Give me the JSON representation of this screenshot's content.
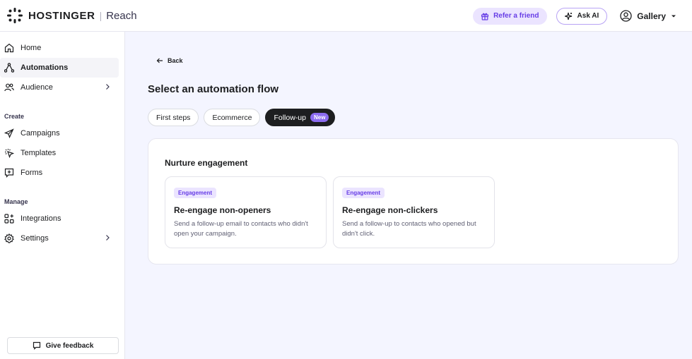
{
  "brand": {
    "name": "HOSTINGER",
    "separator": "|",
    "product": "Reach"
  },
  "header": {
    "refer_label": "Refer a friend",
    "askai_label": "Ask AI",
    "account_name": "Gallery"
  },
  "sidebar": {
    "items": [
      {
        "label": "Home",
        "icon": "home-icon"
      },
      {
        "label": "Automations",
        "icon": "automation-icon",
        "active": true
      },
      {
        "label": "Audience",
        "icon": "users-icon",
        "has_chevron": true
      }
    ],
    "create_label": "Create",
    "create_items": [
      {
        "label": "Campaigns",
        "icon": "send-icon"
      },
      {
        "label": "Templates",
        "icon": "template-icon"
      },
      {
        "label": "Forms",
        "icon": "form-icon"
      }
    ],
    "manage_label": "Manage",
    "manage_items": [
      {
        "label": "Integrations",
        "icon": "integrations-icon"
      },
      {
        "label": "Settings",
        "icon": "gear-icon",
        "has_chevron": true
      }
    ],
    "feedback_label": "Give feedback"
  },
  "main": {
    "back_label": "Back",
    "title": "Select an automation flow",
    "tabs": [
      {
        "label": "First steps"
      },
      {
        "label": "Ecommerce"
      },
      {
        "label": "Follow-up",
        "active": true,
        "badge": "New"
      }
    ],
    "panel": {
      "title": "Nurture engagement",
      "cards": [
        {
          "tag": "Engagement",
          "title": "Re-engage non-openers",
          "description": "Send a follow-up email to contacts who didn't open your campaign."
        },
        {
          "tag": "Engagement",
          "title": "Re-engage non-clickers",
          "description": "Send a follow-up to contacts who opened but didn't click."
        }
      ]
    }
  },
  "colors": {
    "accent": "#673de6",
    "accent_light": "#ebe4ff",
    "background": "#f4f5ff"
  }
}
